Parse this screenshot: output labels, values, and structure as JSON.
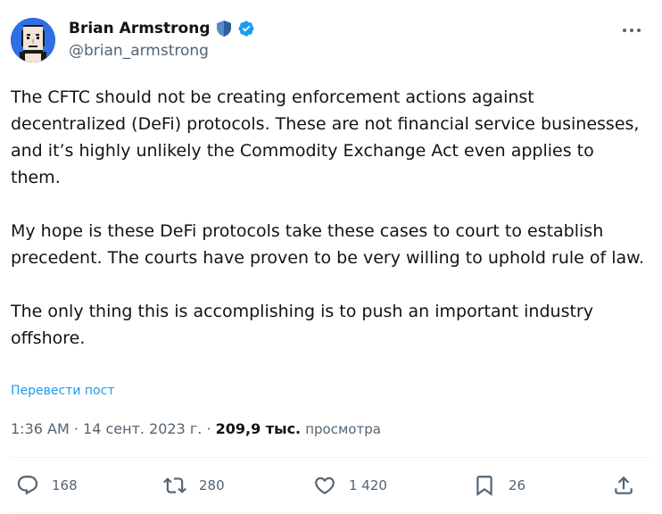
{
  "author": {
    "display_name": "Brian Armstrong",
    "handle": "@brian_armstrong"
  },
  "tweet": {
    "paragraphs": [
      "The CFTC should not be creating enforcement actions against decentralized (DeFi) protocols. These are not financial service businesses, and it’s highly unlikely the Commodity Exchange Act even applies to them.",
      "My hope is these DeFi protocols take these cases to court to establish precedent. The courts have proven to be very willing to uphold rule of law.",
      "The only thing this is accomplishing is to push an important industry offshore."
    ],
    "translate_label": "Перевести пост"
  },
  "meta": {
    "time": "1:36 AM",
    "separator": " · ",
    "date": "14 сент. 2023 г.",
    "views_count": "209,9 тыс.",
    "views_label": "просмотра"
  },
  "actions": {
    "replies": "168",
    "reposts": "280",
    "likes": "1 420",
    "bookmarks": "26"
  },
  "colors": {
    "accent": "#1d9bf0",
    "text": "#0f1419",
    "secondary": "#536471",
    "avatar_bg": "#2f6fe4"
  },
  "icons": [
    "shield-icon",
    "verified-icon",
    "more-icon",
    "reply-icon",
    "retweet-icon",
    "like-icon",
    "bookmark-icon",
    "share-icon"
  ]
}
